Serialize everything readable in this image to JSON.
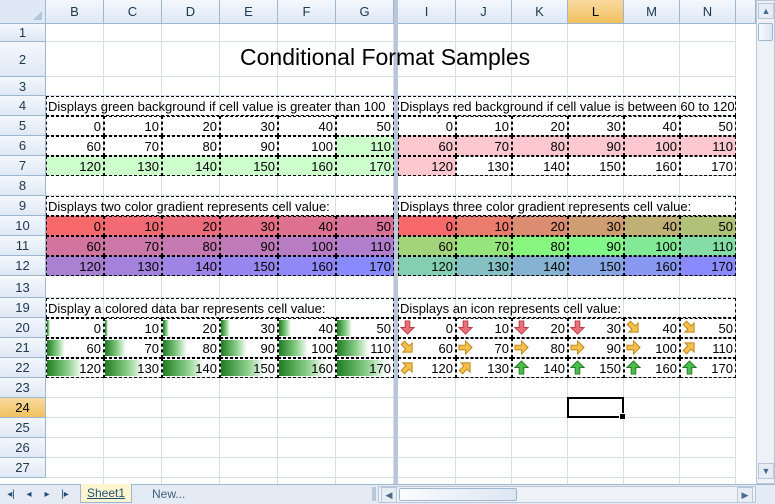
{
  "workbook": {
    "title": "Conditional Format Samples",
    "columns": [
      "B",
      "C",
      "D",
      "E",
      "F",
      "G",
      "I",
      "J",
      "K",
      "L",
      "M",
      "N"
    ],
    "rows": [
      "1",
      "2",
      "3",
      "4",
      "5",
      "6",
      "7",
      "8",
      "9",
      "10",
      "11",
      "12",
      "13",
      "19",
      "20",
      "21",
      "22",
      "23",
      "24",
      "25",
      "26",
      "27"
    ],
    "selected_column": "L",
    "selected_row": "24"
  },
  "sections": {
    "green_bg": {
      "caption": "Displays green background if cell value is greater than 100",
      "rows": [
        [
          0,
          10,
          20,
          30,
          40,
          50
        ],
        [
          60,
          70,
          80,
          90,
          100,
          110
        ],
        [
          120,
          130,
          140,
          150,
          160,
          170
        ]
      ],
      "color": "#ccffcc"
    },
    "red_bg": {
      "caption": "Displays red background if cell value is between 60 to 120",
      "rows": [
        [
          0,
          10,
          20,
          30,
          40,
          50
        ],
        [
          60,
          70,
          80,
          90,
          100,
          110
        ],
        [
          120,
          130,
          140,
          150,
          160,
          170
        ]
      ],
      "color": "#ffc7ce"
    },
    "two_color": {
      "caption": "Displays two color gradient represents cell value:",
      "rows": [
        [
          0,
          10,
          20,
          30,
          40,
          50
        ],
        [
          60,
          70,
          80,
          90,
          100,
          110
        ],
        [
          120,
          130,
          140,
          150,
          160,
          170
        ]
      ],
      "start_color": "#f8696b",
      "end_color": "#8a8aff"
    },
    "three_color": {
      "caption": "Displays three color gradient represents cell value:",
      "rows": [
        [
          0,
          10,
          20,
          30,
          40,
          50
        ],
        [
          60,
          70,
          80,
          90,
          100,
          110
        ],
        [
          120,
          130,
          140,
          150,
          160,
          170
        ]
      ],
      "start_color": "#f8696b",
      "mid_color": "#80ff80",
      "end_color": "#8a8aff"
    },
    "data_bar": {
      "caption": "Display a colored data bar represents cell value:",
      "rows": [
        [
          0,
          10,
          20,
          30,
          40,
          50
        ],
        [
          60,
          70,
          80,
          90,
          100,
          110
        ],
        [
          120,
          130,
          140,
          150,
          160,
          170
        ]
      ],
      "bar_color": "#1f7c1f"
    },
    "icons": {
      "caption": "Displays an icon represents cell value:",
      "rows": [
        [
          0,
          10,
          20,
          30,
          40,
          50
        ],
        [
          60,
          70,
          80,
          90,
          100,
          110
        ],
        [
          120,
          130,
          140,
          150,
          160,
          170
        ]
      ],
      "icons": [
        [
          "arrow-down-icon",
          "arrow-down-icon",
          "arrow-down-icon",
          "arrow-down-icon",
          "arrow-down-right-icon",
          "arrow-down-right-icon"
        ],
        [
          "arrow-down-right-icon",
          "arrow-right-icon",
          "arrow-right-icon",
          "arrow-right-icon",
          "arrow-right-icon",
          "arrow-up-right-icon"
        ],
        [
          "arrow-up-right-icon",
          "arrow-up-right-icon",
          "arrow-up-icon",
          "arrow-up-icon",
          "arrow-up-icon",
          "arrow-up-icon"
        ]
      ]
    }
  },
  "tabs": {
    "sheet1": "Sheet1",
    "new": "New..."
  }
}
